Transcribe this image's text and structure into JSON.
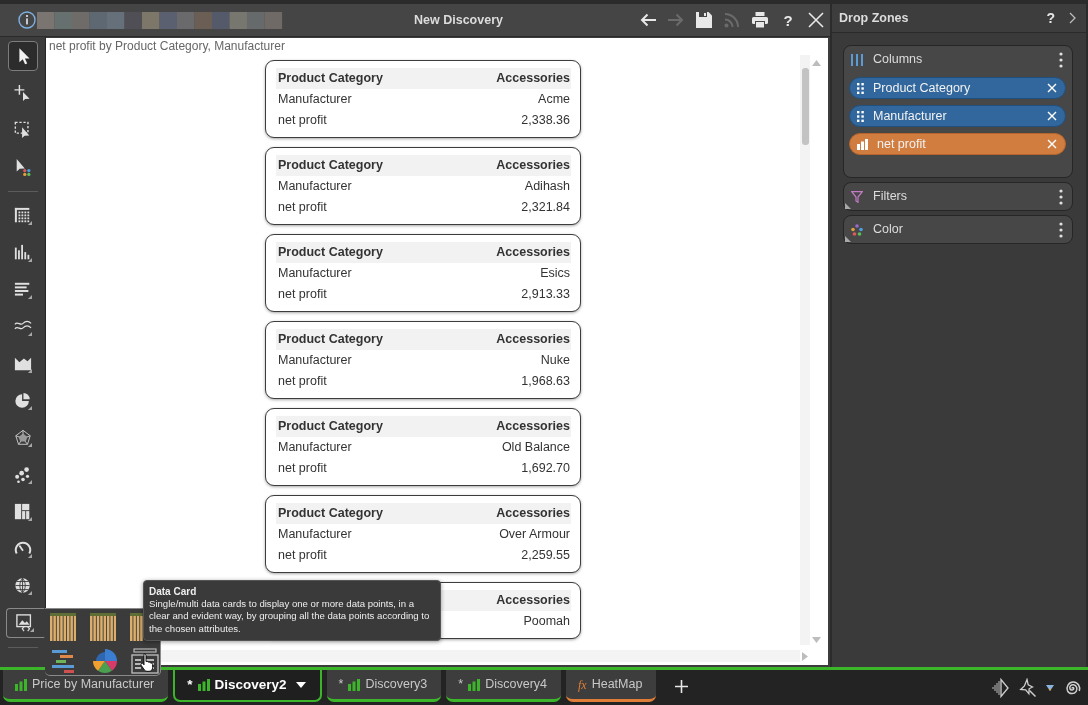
{
  "title_bar": {
    "title": "New Discovery",
    "actions": [
      {
        "disabled": false
      },
      {
        "disabled": true
      },
      {
        "disabled": false
      },
      {
        "disabled": true
      },
      {
        "disabled": false
      },
      {
        "label": "?",
        "disabled": false
      },
      {
        "disabled": false
      }
    ]
  },
  "tools": [
    {
      "selected": true,
      "expanded": false
    },
    {
      "selected": false,
      "expanded": false
    },
    {
      "selected": false,
      "expanded": false
    },
    {
      "selected": false,
      "expanded": false
    },
    {
      "selected": false,
      "expanded": false
    },
    {
      "selected": false,
      "expanded": false
    },
    {
      "selected": false,
      "expanded": false
    },
    {
      "selected": false,
      "expanded": false
    },
    {
      "selected": false,
      "expanded": false
    },
    {
      "selected": false,
      "expanded": false
    },
    {
      "selected": false,
      "expanded": false
    },
    {
      "selected": false,
      "expanded": false
    },
    {
      "selected": false,
      "expanded": false
    },
    {
      "selected": false,
      "expanded": false
    },
    {
      "selected": false,
      "expanded": false
    },
    {
      "selected": false,
      "expanded": true
    }
  ],
  "canvas": {
    "caption": "net profit by Product Category, Manufacturer",
    "cards": [
      {
        "header": {
          "label": "Product Category",
          "value": "Accessories"
        },
        "rows": [
          {
            "label": "Manufacturer",
            "value": "Acme"
          },
          {
            "label": "net profit",
            "value": "2,338.36"
          }
        ]
      },
      {
        "header": {
          "label": "Product Category",
          "value": "Accessories"
        },
        "rows": [
          {
            "label": "Manufacturer",
            "value": "Adihash"
          },
          {
            "label": "net profit",
            "value": "2,321.84"
          }
        ]
      },
      {
        "header": {
          "label": "Product Category",
          "value": "Accessories"
        },
        "rows": [
          {
            "label": "Manufacturer",
            "value": "Esics"
          },
          {
            "label": "net profit",
            "value": "2,913.33"
          }
        ]
      },
      {
        "header": {
          "label": "Product Category",
          "value": "Accessories"
        },
        "rows": [
          {
            "label": "Manufacturer",
            "value": "Nuke"
          },
          {
            "label": "net profit",
            "value": "1,968.63"
          }
        ]
      },
      {
        "header": {
          "label": "Product Category",
          "value": "Accessories"
        },
        "rows": [
          {
            "label": "Manufacturer",
            "value": "Old Balance"
          },
          {
            "label": "net profit",
            "value": "1,692.70"
          }
        ]
      },
      {
        "header": {
          "label": "Product Category",
          "value": "Accessories"
        },
        "rows": [
          {
            "label": "Manufacturer",
            "value": "Over Armour"
          },
          {
            "label": "net profit",
            "value": "2,259.55"
          }
        ]
      },
      {
        "header": {
          "value": "Accessories"
        },
        "rows": [
          {
            "value": "Poomah"
          }
        ]
      }
    ]
  },
  "tooltip": {
    "title": "Data Card",
    "text": "Single/multi data cards to display one or more data points, in a clear and evident way, by grouping all the data points according to the chosen attributes."
  },
  "drop_zones": {
    "title": "Drop Zones",
    "help": "?",
    "zones": [
      {
        "name": "Columns",
        "kind": "columns",
        "fields": [
          {
            "name": "Product Category",
            "kind": "dimension"
          },
          {
            "name": "Manufacturer",
            "kind": "dimension"
          },
          {
            "name": "net profit",
            "kind": "measure"
          }
        ]
      },
      {
        "name": "Filters",
        "kind": "filters"
      },
      {
        "name": "Color",
        "kind": "color"
      }
    ]
  },
  "tabs": [
    {
      "label": "Price by Manufacturer",
      "kind": "discovery",
      "selected": false
    },
    {
      "marker": "*",
      "label": "Discovery2",
      "kind": "discovery",
      "selected": true
    },
    {
      "marker": "*",
      "label": "Discovery3",
      "kind": "discovery",
      "selected": false
    },
    {
      "marker": "*",
      "label": "Discovery4",
      "kind": "discovery",
      "selected": false
    },
    {
      "symbol": "fx",
      "label": "HeatMap",
      "kind": "formula",
      "selected": false
    }
  ]
}
